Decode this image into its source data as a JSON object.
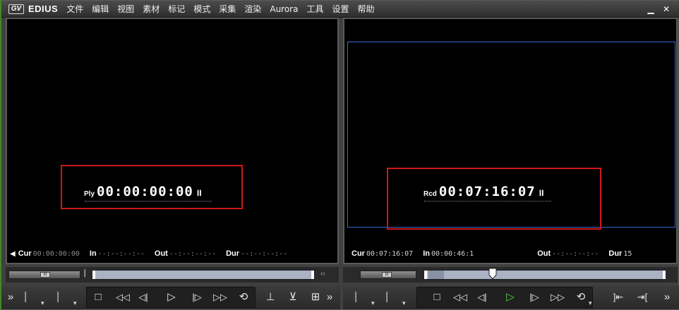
{
  "app": {
    "name": "EDIUS",
    "logo_text": "GV"
  },
  "menu": [
    "文件",
    "编辑",
    "视图",
    "素材",
    "标记",
    "模式",
    "采集",
    "渲染",
    "Aurora",
    "工具",
    "设置",
    "帮助"
  ],
  "window": {
    "minimize": "▁",
    "close": "✕"
  },
  "player": {
    "tc_prefix": "Ply",
    "timecode": "00:00:00:00",
    "pause_glyph": "II",
    "cur_label": "Cur",
    "cur_value": "00:00:00:00",
    "in_label": "In",
    "in_value": "--:--:--:--",
    "out_label": "Out",
    "out_value": "--:--:--:--",
    "dur_label": "Dur",
    "dur_value": "--:--:--:--"
  },
  "recorder": {
    "tc_prefix": "Rcd",
    "timecode": "00:07:16:07",
    "pause_glyph": "II",
    "cur_label": "Cur",
    "cur_value": "00:07:16:07",
    "in_label": "In",
    "in_value": "00:00:46:1",
    "out_label": "Out",
    "out_value": "--:--:--:--",
    "dur_label": "Dur",
    "dur_value": "15"
  },
  "player_scrub": {
    "position": 0.0,
    "shuttle_glyph": "III"
  },
  "recorder_scrub": {
    "position": 0.16,
    "shuttle_glyph": "III"
  },
  "icons": {
    "more": "»",
    "set_in": "⎸",
    "dropdown": "▾",
    "stop": "□",
    "rewind": "◁◁",
    "step_back": "◁|",
    "play": "▷",
    "step_fwd": "|▷",
    "fast_fwd": "▷▷",
    "loop": "⟲",
    "insert": "⊥",
    "overwrite": "⊻",
    "multi": "⊞",
    "prev_edit": "]⇤",
    "next_edit": "⇥[",
    "link": "‹›"
  },
  "colors": {
    "highlight_box": "#d01818",
    "safe_area": "#3a6ad0",
    "play_active": "#56d44a"
  }
}
